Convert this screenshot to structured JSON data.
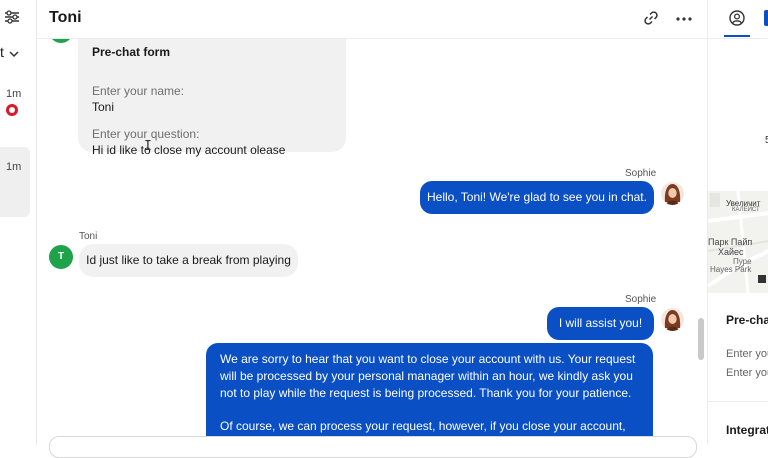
{
  "header": {
    "title": "Toni"
  },
  "left_list": {
    "selected_prefix": "t",
    "times": [
      "1m",
      "1m"
    ]
  },
  "chat": {
    "prechat_form": {
      "title": "Pre-chat form",
      "name_label": "Enter your name:",
      "name_value": "Toni",
      "question_label": "Enter your question:",
      "question_value": "Hi id like to close my account olease"
    },
    "messages": [
      {
        "author": "Sophie",
        "direction": "out",
        "text": "Hello, Toni! We're glad to see you in chat."
      },
      {
        "author": "Toni",
        "direction": "in",
        "avatar_letter": "T",
        "text": "Id just like to take a break from playing"
      },
      {
        "author": "Sophie",
        "direction": "out",
        "text": "I will assist you!"
      },
      {
        "author": "Sophie",
        "direction": "out",
        "paragraph1": "We are sorry to hear that you want to close your account with us. Your request will be processed by your personal manager within an hour, we kindly ask you not to play while the request is being processed. Thank you for your patience.",
        "paragraph2": "Of course, we can process your request, however, if you close your account, you will"
      }
    ]
  },
  "right_panel": {
    "tick_text": "5",
    "map": {
      "zoom_label": "Увеличит",
      "street": "КАЛЕЙСТ",
      "label1": "Парк Пайп",
      "label2": "Хайес",
      "label3": "Пуре",
      "label4": "Hayes Park"
    },
    "section_title": "Pre-chat",
    "field1": "Enter you",
    "field2": "Enter you",
    "integrations_title": "Integrat"
  },
  "colors": {
    "accent": "#0a4fc4",
    "avatar_green": "#1ea34b",
    "badge_red": "#d91a2a"
  }
}
